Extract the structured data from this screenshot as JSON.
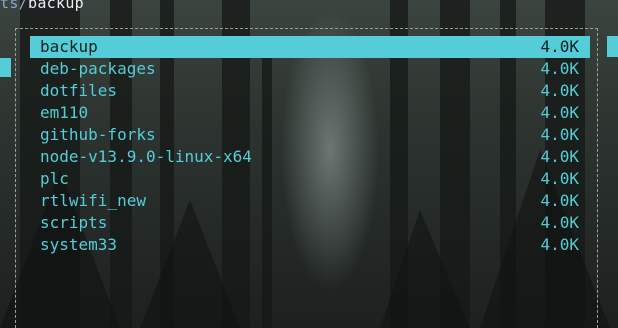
{
  "path": {
    "prefix": "ts",
    "separator": "/",
    "dir": "backup"
  },
  "colors": {
    "accent": "#55cdd8",
    "selected_text": "#10201f",
    "border": "#9aa19d"
  },
  "entries": [
    {
      "name": "backup",
      "size": "4.0K"
    },
    {
      "name": "deb-packages",
      "size": "4.0K"
    },
    {
      "name": "dotfiles",
      "size": "4.0K"
    },
    {
      "name": "em110",
      "size": "4.0K"
    },
    {
      "name": "github-forks",
      "size": "4.0K"
    },
    {
      "name": "node-v13.9.0-linux-x64",
      "size": "4.0K"
    },
    {
      "name": "plc",
      "size": "4.0K"
    },
    {
      "name": "rtlwifi_new",
      "size": "4.0K"
    },
    {
      "name": "scripts",
      "size": "4.0K"
    },
    {
      "name": "system33",
      "size": "4.0K"
    }
  ],
  "selected_index": 0
}
